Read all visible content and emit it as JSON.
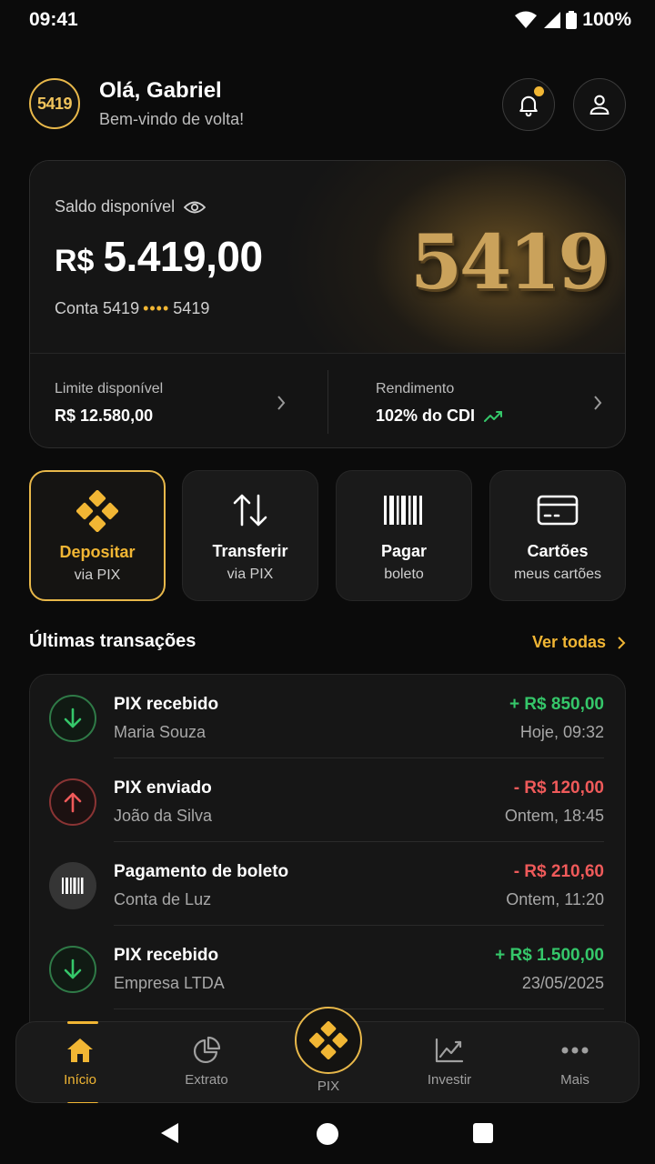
{
  "status": {
    "time": "09:41",
    "battery": "100%"
  },
  "header": {
    "logo": "5419",
    "greeting": "Olá, Gabriel",
    "welcome": "Bem-vindo de volta!"
  },
  "balance": {
    "label": "Saldo disponível",
    "currency": "R$",
    "value": "5.419,00",
    "account_prefix": "Conta 5419",
    "account_mask": "••••",
    "account_suffix": "5419",
    "emblem": "5419"
  },
  "limit": {
    "label": "Limite disponível",
    "value": "R$ 12.580,00"
  },
  "yield": {
    "label": "Rendimento",
    "value": "102% do CDI"
  },
  "actions": [
    {
      "title": "Depositar",
      "subtitle": "via PIX"
    },
    {
      "title": "Transferir",
      "subtitle": "via PIX"
    },
    {
      "title": "Pagar",
      "subtitle": "boleto"
    },
    {
      "title": "Cartões",
      "subtitle": "meus cartões"
    }
  ],
  "transactions_section": {
    "title": "Últimas transações",
    "see_all": "Ver todas"
  },
  "transactions": [
    {
      "name": "PIX recebido",
      "party": "Maria Souza",
      "amount": "+ R$ 850,00",
      "date": "Hoje, 09:32"
    },
    {
      "name": "PIX enviado",
      "party": "João da Silva",
      "amount": "- R$ 120,00",
      "date": "Ontem, 18:45"
    },
    {
      "name": "Pagamento de boleto",
      "party": "Conta de Luz",
      "amount": "- R$ 210,60",
      "date": "Ontem, 11:20"
    },
    {
      "name": "PIX recebido",
      "party": "Empresa LTDA",
      "amount": "+ R$ 1.500,00",
      "date": "23/05/2025"
    }
  ],
  "tabs": [
    {
      "label": "Início"
    },
    {
      "label": "Extrato"
    },
    {
      "label": "PIX"
    },
    {
      "label": "Investir"
    },
    {
      "label": "Mais"
    }
  ],
  "colors": {
    "accent": "#f1b634",
    "positive": "#35c76a",
    "negative": "#ef5a5a",
    "background": "#0b0b0b"
  }
}
